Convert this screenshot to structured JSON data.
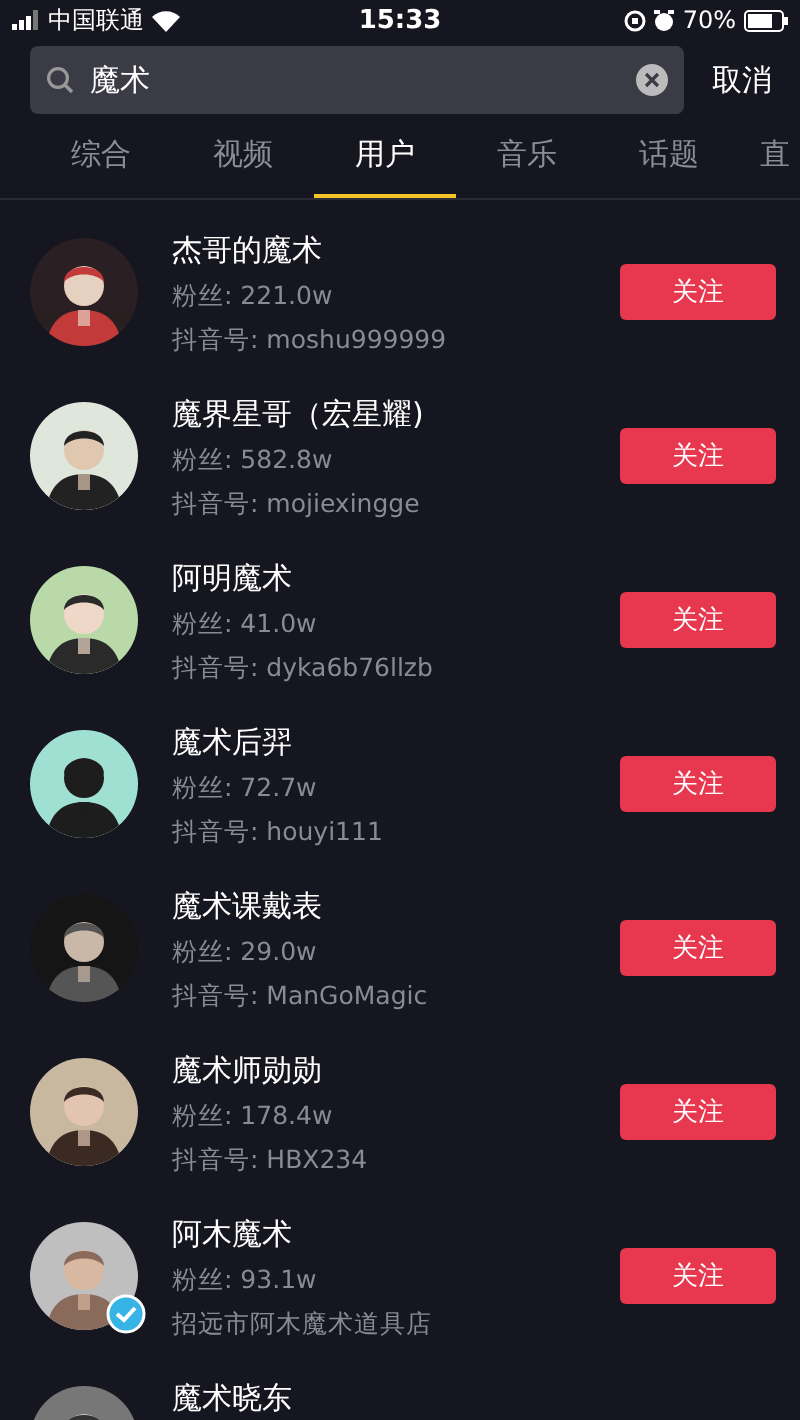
{
  "status_bar": {
    "carrier": "中国联通",
    "time": "15:33",
    "battery": "70%"
  },
  "search": {
    "value": "魔术",
    "cancel": "取消"
  },
  "tabs": [
    {
      "label": "综合",
      "selected": false
    },
    {
      "label": "视频",
      "selected": false
    },
    {
      "label": "用户",
      "selected": true
    },
    {
      "label": "音乐",
      "selected": false
    },
    {
      "label": "话题",
      "selected": false
    },
    {
      "label": "直",
      "selected": false
    }
  ],
  "users": [
    {
      "name": "杰哥的魔术",
      "fans": "粉丝: 221.0w",
      "detail": "抖音号: moshu999999",
      "button": "关注",
      "verified": false
    },
    {
      "name": "魔界星哥（宏星耀)",
      "fans": "粉丝: 582.8w",
      "detail": "抖音号: mojiexingge",
      "button": "关注",
      "verified": false
    },
    {
      "name": "阿明魔术",
      "fans": "粉丝: 41.0w",
      "detail": "抖音号: dyka6b76llzb",
      "button": "关注",
      "verified": false
    },
    {
      "name": "魔术后羿",
      "fans": "粉丝: 72.7w",
      "detail": "抖音号: houyi111",
      "button": "关注",
      "verified": false
    },
    {
      "name": "魔术课戴表",
      "fans": "粉丝: 29.0w",
      "detail": "抖音号: ManGoMagic",
      "button": "关注",
      "verified": false
    },
    {
      "name": "魔术师勋勋",
      "fans": "粉丝: 178.4w",
      "detail": "抖音号: HBX234",
      "button": "关注",
      "verified": false
    },
    {
      "name": "阿木魔术",
      "fans": "粉丝: 93.1w",
      "detail": "招远市阿木魔术道具店",
      "button": "关注",
      "verified": true
    },
    {
      "name": "魔术晓东",
      "verified": false
    }
  ]
}
